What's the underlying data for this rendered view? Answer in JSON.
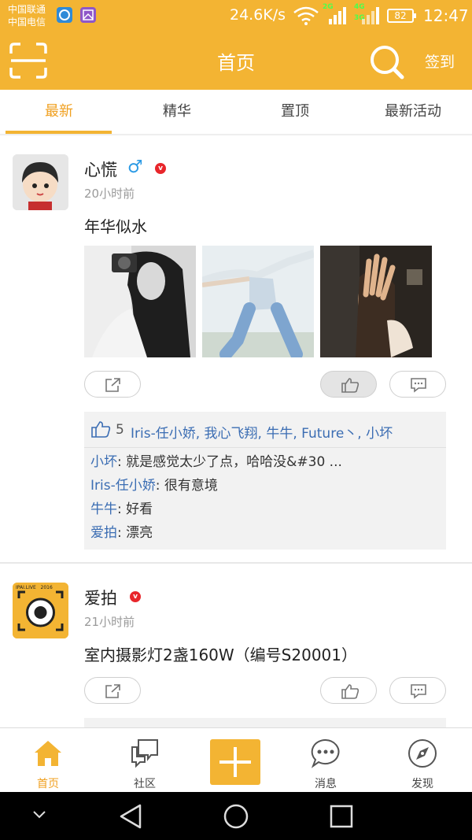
{
  "status_bar": {
    "carrier1": "中国联通",
    "carrier2": "中国电信",
    "net_speed": "24.6K/s",
    "sig_tag_1": "2G",
    "sig_tag_2": "4G",
    "sig_tag_3": "3G",
    "battery": "82",
    "time": "12:47"
  },
  "header": {
    "title": "首页",
    "checkin_label": "签到",
    "scan_icon": "scan-icon",
    "search_icon": "search-icon"
  },
  "tabs": [
    {
      "label": "最新",
      "active": true
    },
    {
      "label": "精华",
      "active": false
    },
    {
      "label": "置顶",
      "active": false
    },
    {
      "label": "最新活动",
      "active": false
    }
  ],
  "posts": [
    {
      "author": "心慌",
      "gender_symbol": "♂",
      "verified": true,
      "verified_mark": "v",
      "time": "20小时前",
      "content": "年华似水",
      "like_count": "5",
      "likers": "Iris-任小娇, 我心飞翔, 牛牛, Future丶, 小坏",
      "comments": [
        {
          "user": "小坏",
          "text": "就是感觉太少了点，哈哈没&#30 ..."
        },
        {
          "user": "Iris-任小娇",
          "text": "很有意境"
        },
        {
          "user": "牛牛",
          "text": "好看"
        },
        {
          "user": "爱拍",
          "text": "漂亮"
        }
      ]
    },
    {
      "author": "爱拍",
      "verified": true,
      "verified_mark": "v",
      "avatar_text": "IPAI.LIVE   2016",
      "time": "21小时前",
      "content": "室内摄影灯2盏160W（编号S20001）"
    }
  ],
  "bottom_nav": [
    {
      "label": "首页",
      "icon": "home-icon",
      "active": true
    },
    {
      "label": "社区",
      "icon": "community-icon",
      "active": false
    },
    {
      "label": "",
      "icon": "plus-icon",
      "active": false
    },
    {
      "label": "消息",
      "icon": "message-icon",
      "active": false
    },
    {
      "label": "发现",
      "icon": "compass-icon",
      "active": false
    }
  ],
  "colors": {
    "brand": "#f3b433",
    "active_text": "#f0a020",
    "link": "#3b6db3",
    "verified": "#e8262b"
  }
}
